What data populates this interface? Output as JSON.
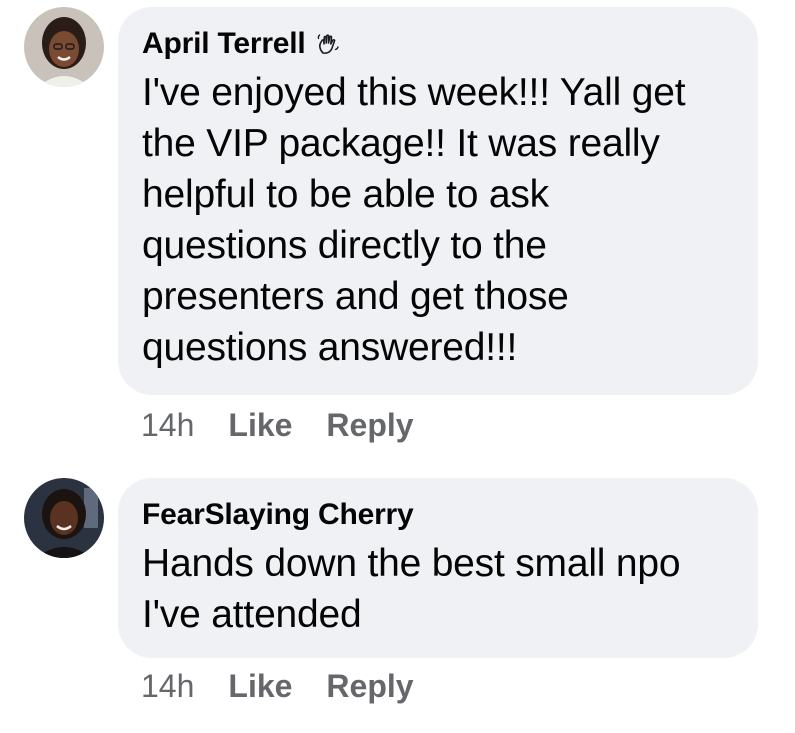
{
  "comments": [
    {
      "author": "April Terrell",
      "badge_icon": "waving-hand-icon",
      "text": "I've enjoyed this week!!! Yall get\nthe VIP package!! It was really\nhelpful to be able to ask\nquestions directly to the\npresenters and get those\nquestions answered!!!",
      "time": "14h",
      "like_label": "Like",
      "reply_label": "Reply"
    },
    {
      "author": "FearSlaying Cherry",
      "text": "Hands down the best small npo\nI've attended",
      "time": "14h",
      "like_label": "Like",
      "reply_label": "Reply"
    }
  ],
  "colors": {
    "bubble": "#eff1f4",
    "primary_text": "#050505",
    "secondary_text": "#65676b"
  }
}
